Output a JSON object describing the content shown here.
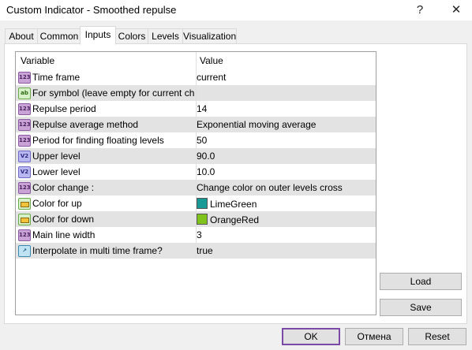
{
  "window": {
    "title": "Custom Indicator - Smoothed repulse",
    "help_glyph": "?",
    "close_glyph": "✕"
  },
  "tabs": [
    "About",
    "Common",
    "Inputs",
    "Colors",
    "Levels",
    "Visualization"
  ],
  "active_tab": "Inputs",
  "grid": {
    "headers": {
      "variable": "Variable",
      "value": "Value"
    },
    "rows": [
      {
        "icon": "int-icon",
        "badge": "123",
        "variable": "Time frame",
        "value": "current"
      },
      {
        "icon": "string-icon",
        "badge": "ab",
        "variable": "For symbol (leave empty for current chart...",
        "value": ""
      },
      {
        "icon": "int-icon",
        "badge": "123",
        "variable": "Repulse period",
        "value": "14"
      },
      {
        "icon": "int-icon",
        "badge": "123",
        "variable": "Repulse average method",
        "value": "Exponential moving average"
      },
      {
        "icon": "int-icon",
        "badge": "123",
        "variable": "Period for finding floating levels",
        "value": "50"
      },
      {
        "icon": "double-icon",
        "badge": "V2",
        "variable": "Upper level",
        "value": "90.0"
      },
      {
        "icon": "double-icon",
        "badge": "V2",
        "variable": "Lower level",
        "value": "10.0"
      },
      {
        "icon": "int-icon",
        "badge": "123",
        "variable": "Color change :",
        "value": "Change color on outer levels cross"
      },
      {
        "icon": "color-icon",
        "badge": "",
        "variable": "Color for up",
        "value": "LimeGreen",
        "swatch": "#1a9a96"
      },
      {
        "icon": "color-icon",
        "badge": "",
        "variable": "Color for down",
        "value": "OrangeRed",
        "swatch": "#7fc31c"
      },
      {
        "icon": "int-icon",
        "badge": "123",
        "variable": "Main line width",
        "value": "3"
      },
      {
        "icon": "bool-icon",
        "badge": "↗",
        "variable": "Interpolate in multi time frame?",
        "value": "true"
      }
    ]
  },
  "side_buttons": {
    "load": "Load",
    "save": "Save"
  },
  "footer_buttons": {
    "ok": "OK",
    "cancel": "Отмена",
    "reset": "Reset"
  }
}
